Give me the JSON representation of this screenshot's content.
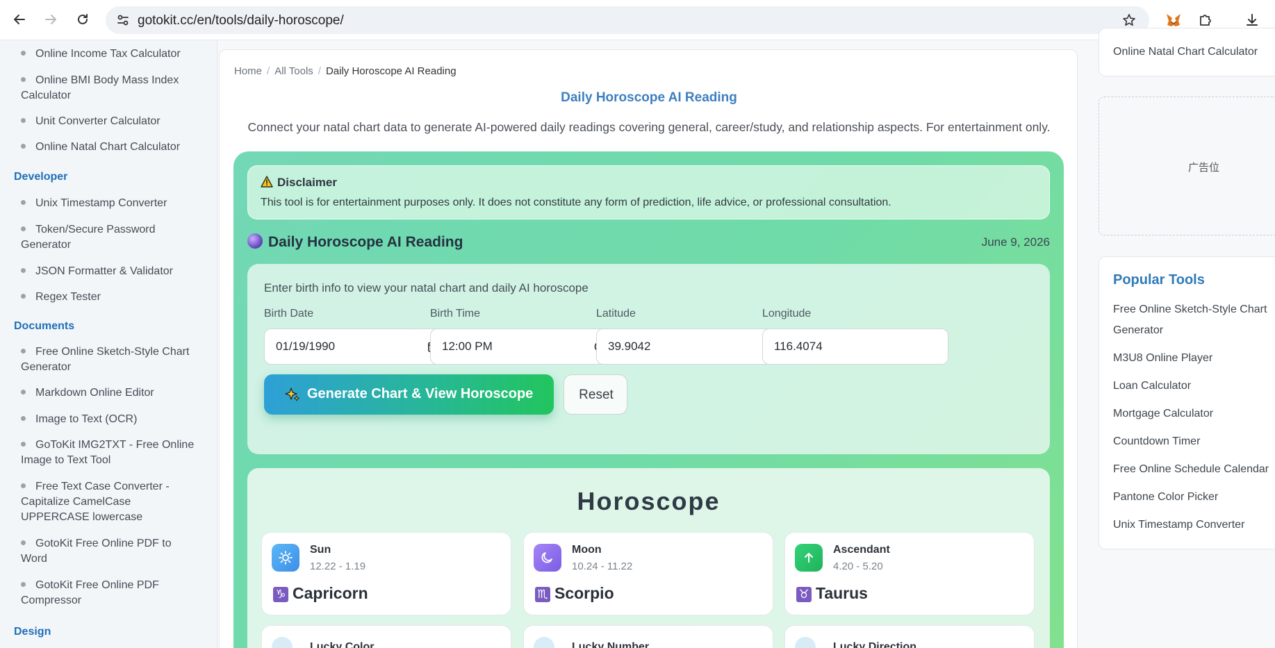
{
  "browser": {
    "url": "gotokit.cc/en/tools/daily-horoscope/"
  },
  "left_sidebar": {
    "items_top": [
      "Online Income Tax Calculator",
      "Online BMI Body Mass Index Calculator",
      "Unit Converter Calculator",
      "Online Natal Chart Calculator"
    ],
    "developer_heading": "Developer",
    "developer_items": [
      "Unix Timestamp Converter",
      "Token/Secure Password Generator",
      "JSON Formatter & Validator",
      "Regex Tester"
    ],
    "documents_heading": "Documents",
    "documents_items": [
      "Free Online Sketch-Style Chart Generator",
      "Markdown Online Editor",
      "Image to Text (OCR)",
      "GoToKit IMG2TXT - Free Online Image to Text Tool",
      "Free Text Case Converter - Capitalize CamelCase UPPERCASE lowercase",
      "GotoKit Free Online PDF to Word",
      "GotoKit Free Online PDF Compressor"
    ],
    "design_heading": "Design"
  },
  "breadcrumb": {
    "home": "Home",
    "all_tools": "All Tools",
    "current": "Daily Horoscope AI Reading",
    "separator": "/"
  },
  "page": {
    "title": "Daily Horoscope AI Reading",
    "description": "Connect your natal chart data to generate AI-powered daily readings covering general, career/study, and relationship aspects. For entertainment only."
  },
  "disclaimer": {
    "title": "Disclaimer",
    "text": "This tool is for entertainment purposes only. It does not constitute any form of prediction, life advice, or professional consultation."
  },
  "reading": {
    "title": "Daily Horoscope AI Reading",
    "date": "June 9, 2026"
  },
  "form": {
    "intro": "Enter birth info to view your natal chart and daily AI horoscope",
    "birth_date_label": "Birth Date",
    "birth_date_value": "01/19/1990",
    "birth_time_label": "Birth Time",
    "birth_time_value": "12:00 PM",
    "latitude_label": "Latitude",
    "latitude_value": "39.9042",
    "longitude_label": "Longitude",
    "longitude_value": "116.4074",
    "generate_label": "Generate Chart & View Horoscope",
    "reset_label": "Reset"
  },
  "horoscope": {
    "title": "Horoscope",
    "signs": [
      {
        "name": "Sun",
        "range": "12.22 - 1.19",
        "zodiac": "Capricorn",
        "glyph": "♑",
        "color": "#4ea8f2"
      },
      {
        "name": "Moon",
        "range": "10.24 - 11.22",
        "zodiac": "Scorpio",
        "glyph": "♏",
        "color": "#8b6cf0"
      },
      {
        "name": "Ascendant",
        "range": "4.20 - 5.20",
        "zodiac": "Taurus",
        "glyph": "♉",
        "color": "#22c55e"
      }
    ],
    "row2": [
      {
        "label": "Lucky Color"
      },
      {
        "label": "Lucky Number"
      },
      {
        "label": "Lucky Direction"
      }
    ]
  },
  "right_sidebar": {
    "top_item": "Online Natal Chart Calculator",
    "ad_label": "广告位",
    "popular_title": "Popular Tools",
    "popular_items": [
      "Free Online Sketch-Style Chart Generator",
      "M3U8 Online Player",
      "Loan Calculator",
      "Mortgage Calculator",
      "Countdown Timer",
      "Free Online Schedule Calendar",
      "Pantone Color Picker",
      "Unix Timestamp Converter"
    ]
  },
  "colors": {
    "accent_blue": "#3d7fc0",
    "heading_blue": "#1e6fb8",
    "panel_green": "#6fdba8",
    "button_gradient_start": "#2ea0d6",
    "button_gradient_end": "#22c55e"
  }
}
